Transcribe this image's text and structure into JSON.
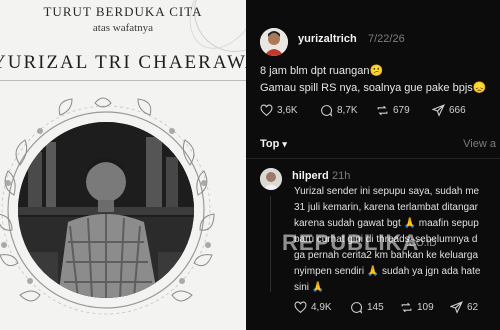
{
  "left_panel": {
    "heading": "TURUT BERDUKA CITA",
    "subheading": "atas wafatnya",
    "name": "YURIZAL TRI CHAERAWAN"
  },
  "post": {
    "username": "yurizaltrich",
    "date": "7/22/26",
    "line1": "8 jam blm dpt ruangan😕",
    "line2": "Gamau spill RS nya, soalnya gue pake bpjs😞",
    "likes": "3,6K",
    "comments": "8,7K",
    "reposts": "679",
    "shares": "666"
  },
  "replies_bar": {
    "top_label": "Top",
    "view_label": "View a"
  },
  "reply": {
    "username": "hilperd",
    "age": "21h",
    "lines": [
      "Yurizal sender ini sepupu saya, sudah me",
      "31 juli kemarin, karena terlambat ditangar",
      "karena sudah gawat bgt 🙏 maafin sepup",
      "baru curhat gini di threads, sebelumnya d",
      "ga pernah cerita2 km bahkan ke keluarga",
      "nyimpen sendiri 🙏 sudah ya jgn ada hate",
      "sini 🙏"
    ],
    "likes": "4,9K",
    "comments": "145",
    "reposts": "109",
    "shares": "62"
  },
  "watermark": {
    "brand": "REPUBLIKA",
    "suffix": ".CO.ID"
  },
  "icons": [
    "heart-icon",
    "comment-icon",
    "repost-icon",
    "share-icon"
  ]
}
